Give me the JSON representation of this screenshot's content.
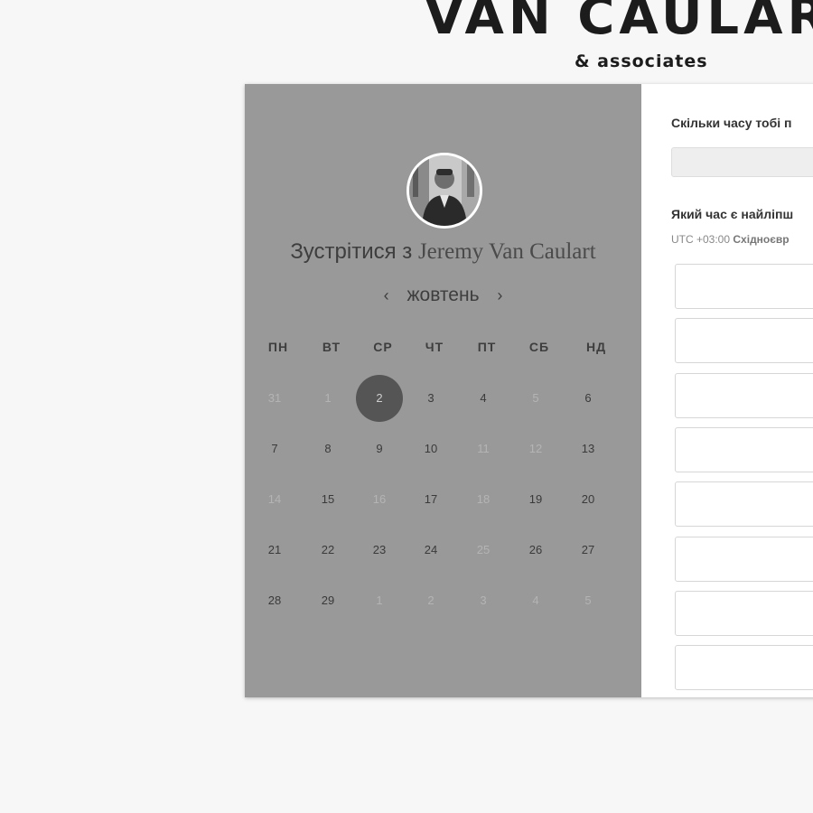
{
  "brand": {
    "name": "VAN CAULAR",
    "tagline": "& associates"
  },
  "host": {
    "meet_prefix": "Зустрітися з",
    "name": "Jeremy Van Caulart"
  },
  "calendar": {
    "month": "жовтень",
    "prev_arrow": "‹",
    "next_arrow": "›",
    "weekdays": [
      "ПН",
      "ВТ",
      "СР",
      "ЧТ",
      "ПТ",
      "СБ",
      "НД"
    ],
    "weeks": [
      [
        {
          "d": "31",
          "muted": true
        },
        {
          "d": "1",
          "muted": true
        },
        {
          "d": "2",
          "selected": true
        },
        {
          "d": "3"
        },
        {
          "d": "4"
        },
        {
          "d": "5",
          "muted": true
        },
        {
          "d": "6"
        }
      ],
      [
        {
          "d": "7"
        },
        {
          "d": "8"
        },
        {
          "d": "9"
        },
        {
          "d": "10"
        },
        {
          "d": "11",
          "muted": true
        },
        {
          "d": "12",
          "muted": true
        },
        {
          "d": "13"
        }
      ],
      [
        {
          "d": "14",
          "muted": true
        },
        {
          "d": "15"
        },
        {
          "d": "16",
          "muted": true
        },
        {
          "d": "17"
        },
        {
          "d": "18",
          "muted": true
        },
        {
          "d": "19"
        },
        {
          "d": "20"
        }
      ],
      [
        {
          "d": "21"
        },
        {
          "d": "22"
        },
        {
          "d": "23"
        },
        {
          "d": "24"
        },
        {
          "d": "25",
          "muted": true
        },
        {
          "d": "26"
        },
        {
          "d": "27"
        }
      ],
      [
        {
          "d": "28"
        },
        {
          "d": "29"
        },
        {
          "d": "1",
          "muted": true
        },
        {
          "d": "2",
          "muted": true
        },
        {
          "d": "3",
          "muted": true
        },
        {
          "d": "4",
          "muted": true
        },
        {
          "d": "5",
          "muted": true
        }
      ]
    ]
  },
  "form": {
    "duration_question": "Скільки часу тобі п",
    "time_question": "Який час є найліпш",
    "timezone_offset": "UTC +03:00",
    "timezone_name": "Східноєвр",
    "slot_count": 8
  },
  "colors": {
    "left_panel": "#999999",
    "selected_day": "#555555",
    "page_bg": "#f7f7f7"
  }
}
